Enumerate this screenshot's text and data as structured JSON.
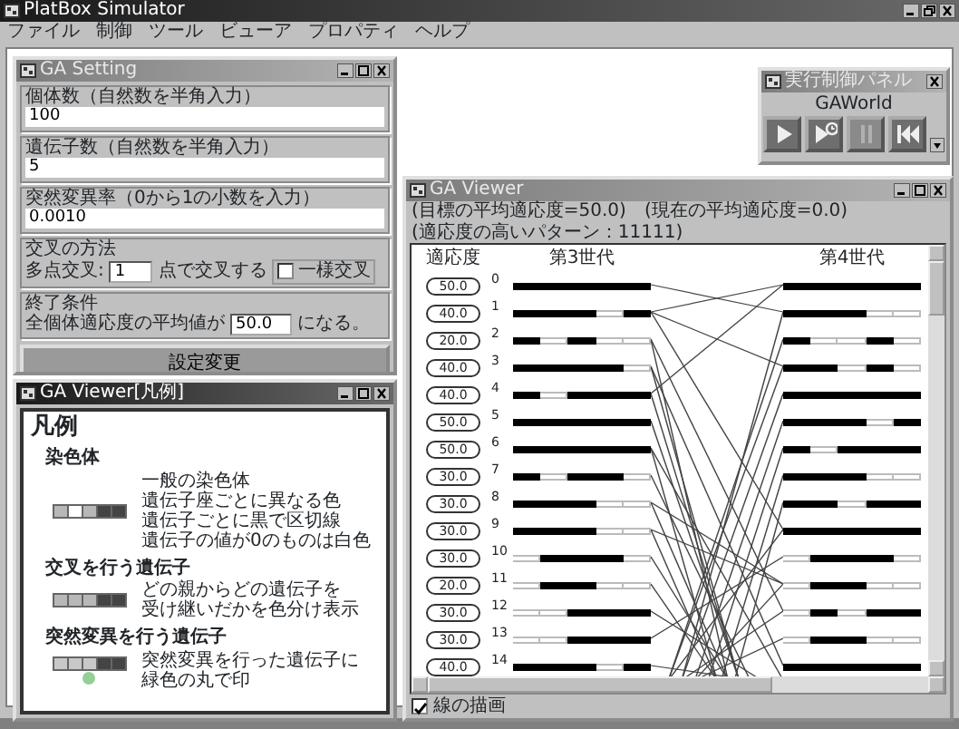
{
  "app": {
    "title": "PlatBox Simulator",
    "active": true,
    "menu": [
      "ファイル",
      "制御",
      "ツール",
      "ビューア",
      "プロパティ",
      "ヘルプ"
    ]
  },
  "ga_setting": {
    "title": "GA Setting",
    "active": false,
    "fields": [
      {
        "label": "個体数（自然数を半角入力）",
        "value": "100"
      },
      {
        "label": "遺伝子数（自然数を半角入力）",
        "value": "5"
      },
      {
        "label": "突然変異率（0から1の小数を入力）",
        "value": "0.0010"
      }
    ],
    "crossover": {
      "legend": "交叉の方法",
      "label": "多点交叉:",
      "value": "1",
      "suffix": "点で交叉する",
      "uniform": {
        "label": "一様交叉",
        "checked": false
      }
    },
    "termination": {
      "legend": "終了条件",
      "label": "全個体適応度の平均値が",
      "value": "50.0",
      "suffix": "になる。"
    },
    "button": "設定変更"
  },
  "legend_window": {
    "title": "GA Viewer[凡例]",
    "active": true,
    "heading": "凡例",
    "sections": [
      {
        "kind": "normal",
        "title": "染色体",
        "lines": [
          "一般の染色体",
          "遺伝子座ごとに異なる色",
          "遺伝子ごとに黒で区切線",
          "遺伝子の値が0のものは白色"
        ]
      },
      {
        "kind": "crossover",
        "title": "交叉を行う遺伝子",
        "lines": [
          "どの親からどの遺伝子を",
          "受け継いだかを色分け表示"
        ]
      },
      {
        "kind": "mutation",
        "title": "突然変異を行う遺伝子",
        "lines": [
          "突然変異を行った遺伝子に",
          "緑色の丸で印"
        ]
      }
    ]
  },
  "control_panel": {
    "title": "実行制御パネル",
    "active": false,
    "world": "GAWorld",
    "buttons": [
      {
        "kind": "play",
        "disabled": false
      },
      {
        "kind": "timer",
        "disabled": false
      },
      {
        "kind": "pause",
        "disabled": true
      },
      {
        "kind": "rewind",
        "disabled": false
      }
    ]
  },
  "viewer": {
    "title": "GA Viewer",
    "active": false,
    "stats": [
      "(目標の平均適応度=50.0)",
      "(現在の平均適応度=0.0)",
      "(適応度の高いパターン：11111)"
    ],
    "fitness_heading": "適応度",
    "generations": [
      "第3世代",
      "第4世代"
    ],
    "rows": [
      {
        "index": "0",
        "fitness": "50.0",
        "gen3": [
          true,
          true,
          true,
          true,
          true
        ],
        "gen4": [
          true,
          true,
          true,
          true,
          true
        ]
      },
      {
        "index": "1",
        "fitness": "40.0",
        "gen3": [
          true,
          true,
          true,
          false,
          true
        ],
        "gen4": [
          true,
          true,
          true,
          false,
          false
        ]
      },
      {
        "index": "2",
        "fitness": "20.0",
        "gen3": [
          true,
          false,
          true,
          false,
          false
        ],
        "gen4": [
          true,
          false,
          false,
          true,
          false
        ]
      },
      {
        "index": "3",
        "fitness": "40.0",
        "gen3": [
          true,
          true,
          true,
          true,
          false
        ],
        "gen4": [
          true,
          true,
          false,
          true,
          false
        ]
      },
      {
        "index": "4",
        "fitness": "40.0",
        "gen3": [
          true,
          false,
          true,
          true,
          true
        ],
        "gen4": [
          true,
          true,
          true,
          true,
          true
        ]
      },
      {
        "index": "5",
        "fitness": "50.0",
        "gen3": [
          true,
          true,
          true,
          true,
          true
        ],
        "gen4": [
          true,
          true,
          true,
          false,
          true
        ]
      },
      {
        "index": "6",
        "fitness": "50.0",
        "gen3": [
          true,
          true,
          true,
          true,
          true
        ],
        "gen4": [
          true,
          false,
          true,
          true,
          true
        ]
      },
      {
        "index": "7",
        "fitness": "30.0",
        "gen3": [
          true,
          false,
          true,
          true,
          false
        ],
        "gen4": [
          true,
          true,
          true,
          false,
          false
        ]
      },
      {
        "index": "8",
        "fitness": "30.0",
        "gen3": [
          true,
          true,
          true,
          false,
          false
        ],
        "gen4": [
          true,
          true,
          false,
          true,
          true
        ]
      },
      {
        "index": "9",
        "fitness": "30.0",
        "gen3": [
          true,
          true,
          true,
          false,
          false
        ],
        "gen4": [
          true,
          true,
          true,
          true,
          true
        ]
      },
      {
        "index": "10",
        "fitness": "30.0",
        "gen3": [
          false,
          true,
          true,
          true,
          false
        ],
        "gen4": [
          false,
          true,
          true,
          true,
          false
        ]
      },
      {
        "index": "11",
        "fitness": "20.0",
        "gen3": [
          false,
          true,
          true,
          false,
          false
        ],
        "gen4": [
          false,
          true,
          true,
          false,
          false
        ]
      },
      {
        "index": "12",
        "fitness": "30.0",
        "gen3": [
          false,
          false,
          true,
          true,
          true
        ],
        "gen4": [
          false,
          true,
          false,
          true,
          true
        ]
      },
      {
        "index": "13",
        "fitness": "30.0",
        "gen3": [
          false,
          false,
          true,
          true,
          true
        ],
        "gen4": [
          false,
          true,
          true,
          false,
          false
        ]
      },
      {
        "index": "14",
        "fitness": "40.0",
        "gen3": [
          true,
          true,
          true,
          false,
          true
        ],
        "gen4": [
          true,
          true,
          true,
          true,
          true
        ]
      }
    ],
    "draw_lines": {
      "label": "線の描画",
      "checked": true
    }
  }
}
